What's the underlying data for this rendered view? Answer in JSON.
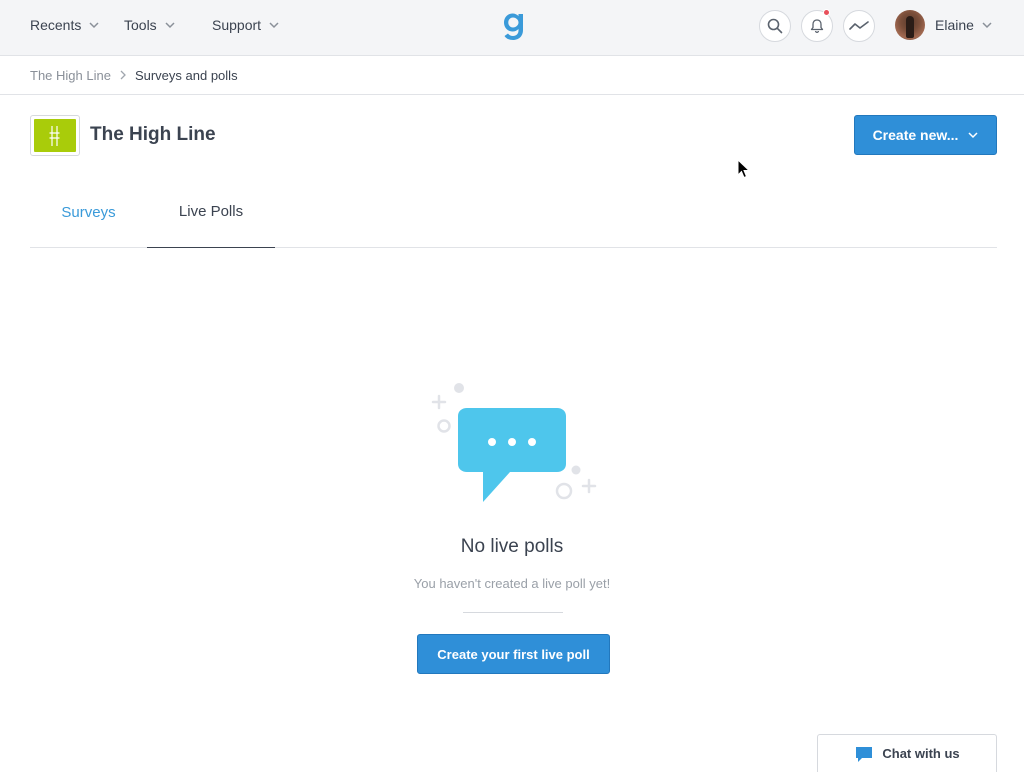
{
  "nav": {
    "recents": "Recents",
    "tools": "Tools",
    "support": "Support",
    "user_name": "Elaine"
  },
  "breadcrumb": {
    "parent": "The High Line",
    "current": "Surveys and polls"
  },
  "header": {
    "title": "The High Line",
    "create_button": "Create new..."
  },
  "tabs": [
    {
      "label": "Surveys",
      "active": false
    },
    {
      "label": "Live Polls",
      "active": true
    }
  ],
  "empty_state": {
    "title": "No live polls",
    "subtitle": "You haven't created a live poll yet!",
    "button": "Create your first live poll"
  },
  "chat": {
    "label": "Chat with us"
  },
  "colors": {
    "accent": "#2f8fd8",
    "tab_link": "#3a9ad9",
    "org_logo": "#a9cc0a",
    "illustration": "#4ec6ec",
    "notification": "#e8505b"
  }
}
